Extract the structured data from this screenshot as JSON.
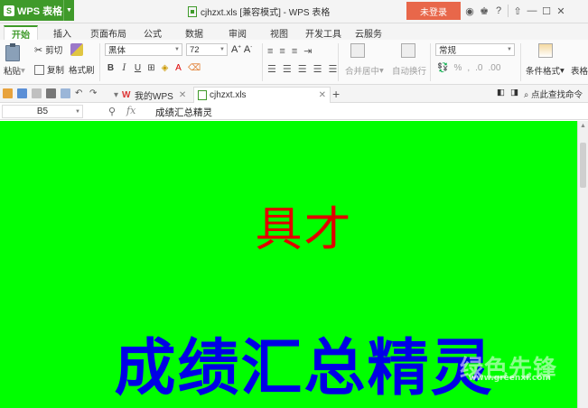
{
  "titlebar": {
    "app_name": "WPS 表格",
    "window_title": "cjhzxt.xls [兼容模式] - WPS 表格",
    "login_label": "未登录"
  },
  "tabs": [
    {
      "label": "开始",
      "active": true
    },
    {
      "label": "插入"
    },
    {
      "label": "页面布局"
    },
    {
      "label": "公式"
    },
    {
      "label": "数据"
    },
    {
      "label": "审阅"
    },
    {
      "label": "视图"
    },
    {
      "label": "开发工具"
    },
    {
      "label": "云服务"
    }
  ],
  "ribbon": {
    "cut": "剪切",
    "copy": "复制",
    "paste": "粘贴",
    "format_painter": "格式刷",
    "font_name": "黑体",
    "font_size": "72",
    "merge_center": "合并居中",
    "wrap_text": "自动换行",
    "number_format": "常规",
    "cond_format": "条件格式",
    "table_style": "表格"
  },
  "quickbar": {
    "doc_tabs": [
      {
        "label": "我的WPS"
      },
      {
        "label": "cjhzxt.xls"
      }
    ],
    "search_hint": "点此查找命令"
  },
  "formula_bar": {
    "cell_ref": "B5",
    "fx": "fx",
    "content": "成绩汇总精灵"
  },
  "sheet": {
    "line1": "具才",
    "line2": "成绩汇总精灵",
    "bg_color": "#00ff00",
    "line1_color": "#e00000",
    "line2_color": "#0000e6"
  },
  "watermark": {
    "text": "绿色先锋",
    "url": "www.greenxf.com"
  }
}
